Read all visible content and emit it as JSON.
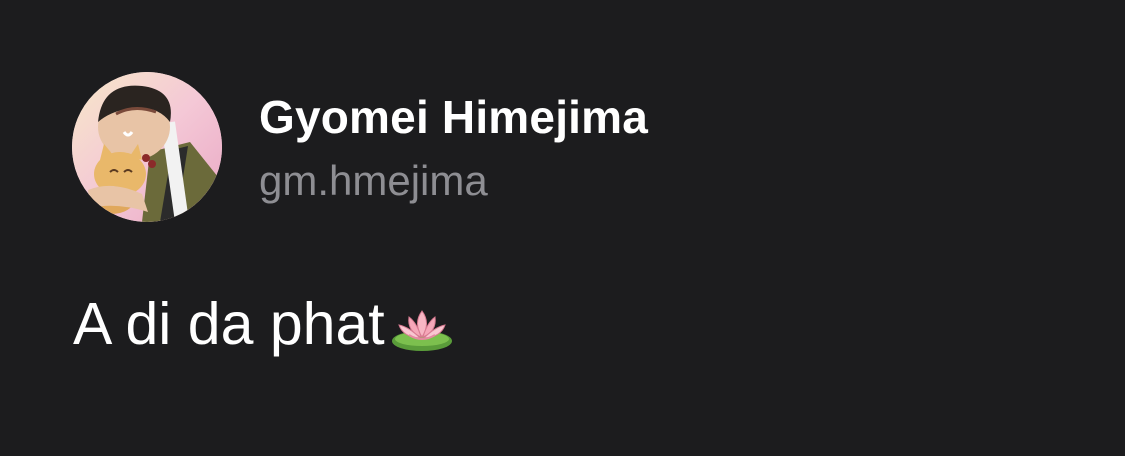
{
  "profile": {
    "display_name": "Gyomei Himejima",
    "username": "gm.hmejima",
    "avatar_icon": "anime-character-avatar",
    "bio_text": "A di da phat",
    "bio_emoji": "lotus-emoji"
  },
  "colors": {
    "background": "#1c1c1e",
    "name": "#ffffff",
    "handle": "#8e8e93",
    "bio": "#ffffff"
  }
}
